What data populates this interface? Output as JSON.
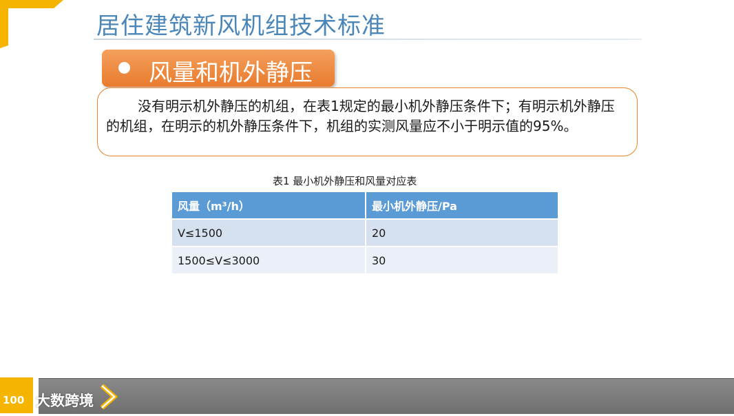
{
  "slide": {
    "title": "居住建筑新风机组技术标准",
    "section_label": "风量和机外静压",
    "body_text": "没有明示机外静压的机组，在表1规定的最小机外静压条件下；有明示机外静压的机组，在明示的机外静压条件下，机组的实测风量应不小于明示值的95%。"
  },
  "table": {
    "caption": "表1   最小机外静压和风量对应表",
    "headers": [
      "风量（m³/h）",
      "最小机外静压/Pa"
    ],
    "rows": [
      [
        "V≤1500",
        "20"
      ],
      [
        "1500≤V≤3000",
        "30"
      ]
    ]
  },
  "footer": {
    "wordmark": "大数跨境",
    "logo_text": "100"
  },
  "colors": {
    "title": "#4a86b8",
    "accent_orange": "#e87b2e",
    "table_header": "#5b9bd5",
    "corner_yellow": "#f5b400",
    "footer_gray": "#7a7a7a"
  }
}
